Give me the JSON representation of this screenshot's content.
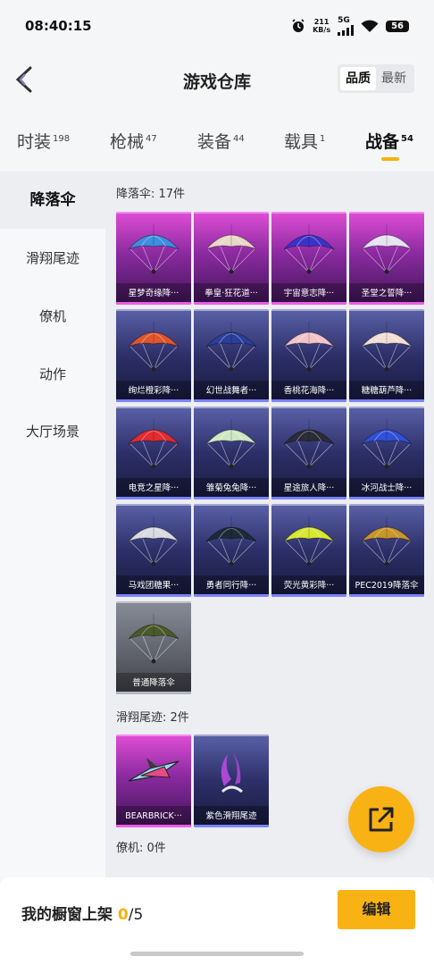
{
  "status_bar": {
    "time": "08:40:15",
    "net_speed_top": "211",
    "net_speed_unit": "KB/s",
    "network": "5G",
    "battery": "56"
  },
  "header": {
    "title": "游戏仓库",
    "sort_options": [
      "品质",
      "最新"
    ],
    "sort_active": "品质"
  },
  "tabs": [
    {
      "label": "时装",
      "count": "198"
    },
    {
      "label": "枪械",
      "count": "47"
    },
    {
      "label": "装备",
      "count": "44"
    },
    {
      "label": "载具",
      "count": "1"
    },
    {
      "label": "战备",
      "count": "54"
    }
  ],
  "active_tab": "战备",
  "sidebar": {
    "items": [
      "降落伞",
      "滑翔尾迹",
      "僚机",
      "动作",
      "大厅场景"
    ],
    "active": "降落伞"
  },
  "sections": {
    "parachute": {
      "title": "降落伞: 17件",
      "items": [
        {
          "name": "星梦奇缘降···",
          "rarity": "purple",
          "icon": "parachute-icon",
          "color": "#3d8fe0"
        },
        {
          "name": "拳皇·狂花道···",
          "rarity": "purple",
          "icon": "parachute-icon",
          "color": "#e8d8c8"
        },
        {
          "name": "宇宙意志降···",
          "rarity": "purple",
          "icon": "parachute-icon",
          "color": "#3a33c8"
        },
        {
          "name": "圣堂之誓降···",
          "rarity": "purple",
          "icon": "parachute-icon",
          "color": "#e6e2f2"
        },
        {
          "name": "绚烂橙彩降···",
          "rarity": "blue",
          "icon": "parachute-icon",
          "color": "#e0552c"
        },
        {
          "name": "幻世战舞者···",
          "rarity": "blue",
          "icon": "parachute-icon",
          "color": "#2a3f9c"
        },
        {
          "name": "香桃花海降···",
          "rarity": "blue",
          "icon": "parachute-icon",
          "color": "#f2c4c8"
        },
        {
          "name": "糖糖葫芦降···",
          "rarity": "blue",
          "icon": "parachute-icon",
          "color": "#f3ded6"
        },
        {
          "name": "电竞之星降···",
          "rarity": "blue",
          "icon": "parachute-icon",
          "color": "#e32b30"
        },
        {
          "name": "雏菊兔兔降···",
          "rarity": "blue",
          "icon": "parachute-icon",
          "color": "#cfe8c2"
        },
        {
          "name": "星途旅人降···",
          "rarity": "blue",
          "icon": "parachute-icon",
          "color": "#2a2d38"
        },
        {
          "name": "冰河战士降···",
          "rarity": "blue",
          "icon": "parachute-icon",
          "color": "#3050d8"
        },
        {
          "name": "马戏团糖果···",
          "rarity": "blue",
          "icon": "parachute-icon",
          "color": "#d8dbe0"
        },
        {
          "name": "勇者同行降···",
          "rarity": "blue",
          "icon": "parachute-icon",
          "color": "#1e2a38"
        },
        {
          "name": "荧光黄彩降···",
          "rarity": "blue",
          "icon": "parachute-icon",
          "color": "#d8e830"
        },
        {
          "name": "PEC2019降落伞",
          "rarity": "blue",
          "icon": "parachute-icon",
          "color": "#c8962a"
        },
        {
          "name": "普通降落伞",
          "rarity": "grey",
          "icon": "parachute-icon",
          "color": "#4a5a2a"
        }
      ]
    },
    "glide_trail": {
      "title": "滑翔尾迹: 2件",
      "items": [
        {
          "name": "BEARBRICK···",
          "rarity": "purple",
          "icon": "glider-icon",
          "color": "#9ad8f0"
        },
        {
          "name": "紫色滑翔尾迹",
          "rarity": "blue",
          "icon": "smoke-trail-icon",
          "color": "#b84ae0"
        }
      ]
    },
    "wingman": {
      "title": "僚机: 0件"
    }
  },
  "fab": {
    "icon": "share-out-icon"
  },
  "bottom_bar": {
    "showcase_label": "我的橱窗上架 ",
    "showcase_count": "0",
    "showcase_total": "/5",
    "edit_label": "编辑"
  },
  "colors": {
    "accent": "#f9b214",
    "purple_card": "#b03dc0",
    "blue_card": "#2d2f68",
    "grey_card": "#5d6069"
  }
}
